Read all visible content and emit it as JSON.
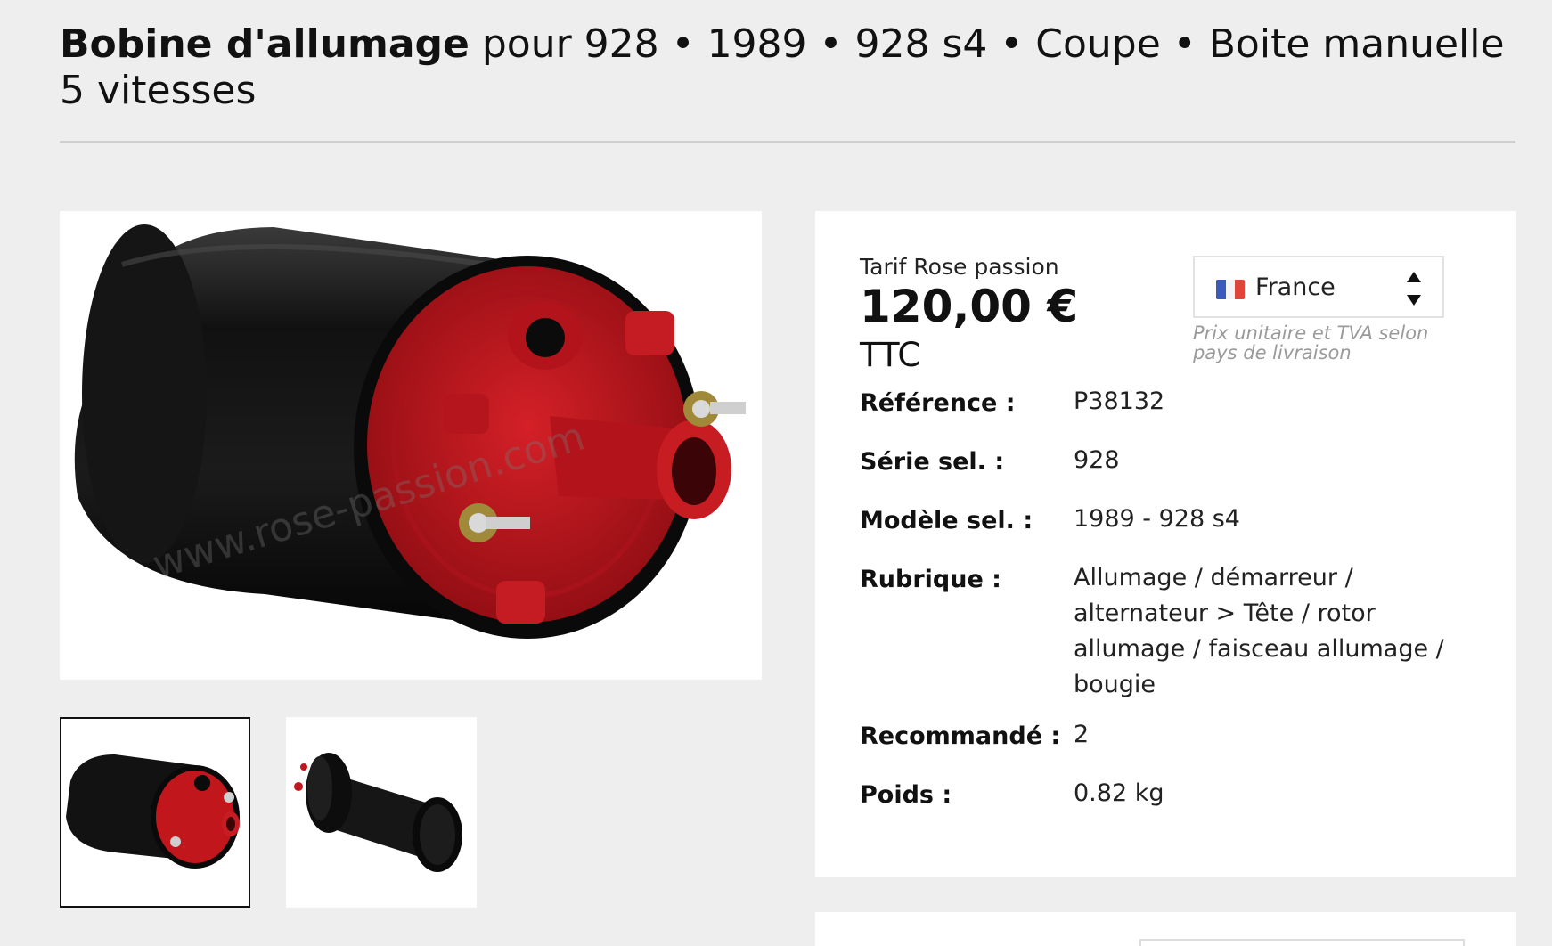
{
  "header": {
    "title_bold": "Bobine d'allumage",
    "title_rest": " pour 928 • 1989 • 928 s4 • Coupe • Boite manuelle 5 vitesses"
  },
  "gallery": {
    "main_image": "ignition-coil-front-view",
    "watermark": "www.rose-passion.com",
    "thumbnails": [
      {
        "image": "ignition-coil-front-view",
        "selected": true
      },
      {
        "image": "ignition-coil-rear-view",
        "selected": false
      }
    ]
  },
  "price_box": {
    "label": "Tarif Rose passion",
    "price": "120,00 €",
    "tax_label": "TTC",
    "country": {
      "selected": "France",
      "flag_colors": [
        "#3a5bbd",
        "#ffffff",
        "#e2433a"
      ]
    },
    "vat_note": "Prix unitaire et TVA selon pays de livraison"
  },
  "specs": [
    {
      "label": "Référence :",
      "value": "P38132"
    },
    {
      "label": "Série sel. :",
      "value": "928"
    },
    {
      "label": "Modèle sel. :",
      "value": "1989 - 928 s4"
    },
    {
      "label": "Rubrique :",
      "value": "Allumage / démarreur / alternateur > Tête / rotor allumage / faisceau allumage / bougie"
    },
    {
      "label": "Recommandé :",
      "value": "2"
    },
    {
      "label": "Poids :",
      "value": "0.82 kg"
    }
  ],
  "colors": {
    "background": "#eeeeee",
    "coil_body": "#121212",
    "coil_cap": "#c1161c"
  }
}
